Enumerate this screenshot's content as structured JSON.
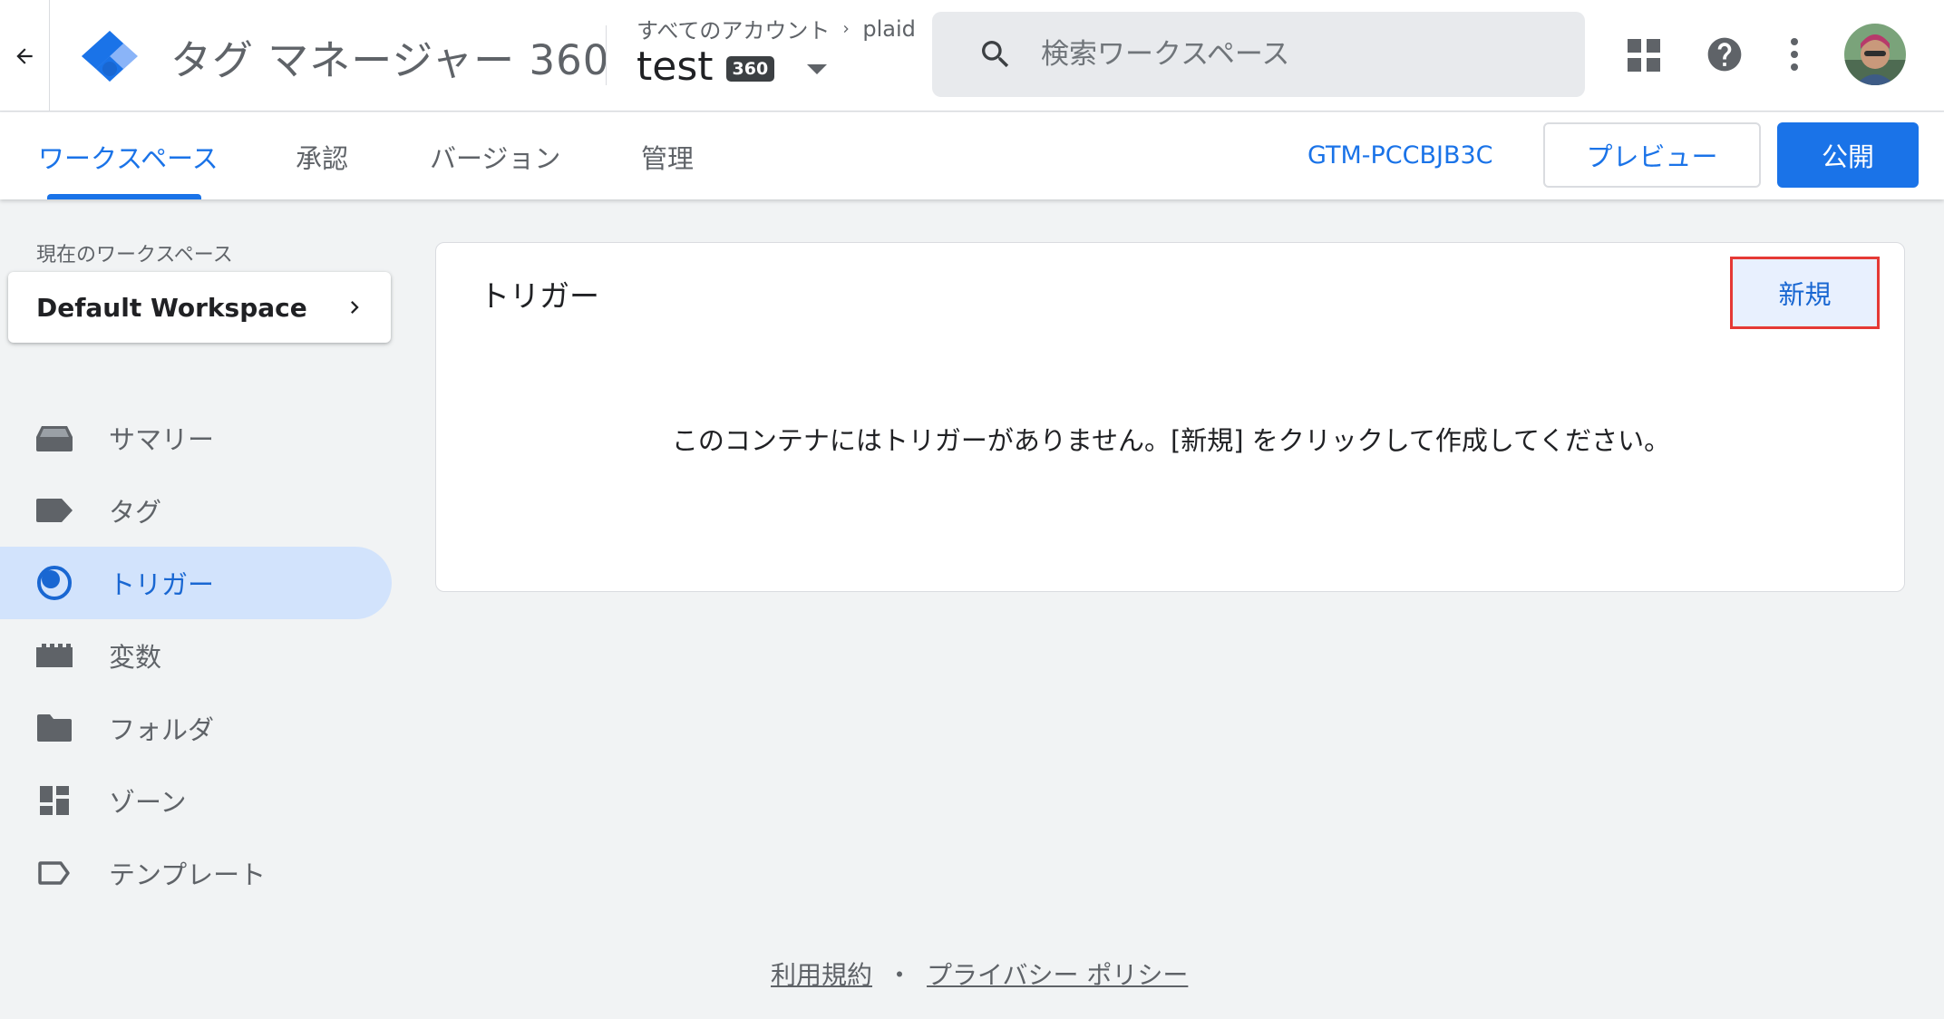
{
  "header": {
    "product_name": "タグ マネージャー 360",
    "breadcrumb_accounts": "すべてのアカウント",
    "breadcrumb_account": "plaid",
    "container_name": "test",
    "container_badge": "360",
    "search_placeholder": "検索ワークスペース"
  },
  "tabs": [
    {
      "label": "ワークスペース",
      "active": true
    },
    {
      "label": "承認"
    },
    {
      "label": "バージョン"
    },
    {
      "label": "管理"
    }
  ],
  "toolbar": {
    "container_id": "GTM-PCCBJB3C",
    "preview_label": "プレビュー",
    "publish_label": "公開"
  },
  "sidebar": {
    "workspace_label": "現在のワークスペース",
    "workspace_name": "Default Workspace",
    "items": [
      {
        "label": "サマリー",
        "icon": "inbox-icon"
      },
      {
        "label": "タグ",
        "icon": "label-icon"
      },
      {
        "label": "トリガー",
        "icon": "trigger-icon",
        "active": true
      },
      {
        "label": "変数",
        "icon": "variables-icon"
      },
      {
        "label": "フォルダ",
        "icon": "folder-icon"
      },
      {
        "label": "ゾーン",
        "icon": "dashboard-icon"
      },
      {
        "label": "テンプレート",
        "icon": "label-outline-icon"
      }
    ]
  },
  "main": {
    "title": "トリガー",
    "new_label": "新規",
    "empty_message": "このコンテナにはトリガーがありません。[新規] をクリックして作成してください。"
  },
  "footer": {
    "terms": "利用規約",
    "separator": "・",
    "privacy": "プライバシー ポリシー"
  },
  "colors": {
    "accent": "#1a73e8",
    "active_nav_bg": "#d2e3fc",
    "highlight_border": "#e53935"
  }
}
